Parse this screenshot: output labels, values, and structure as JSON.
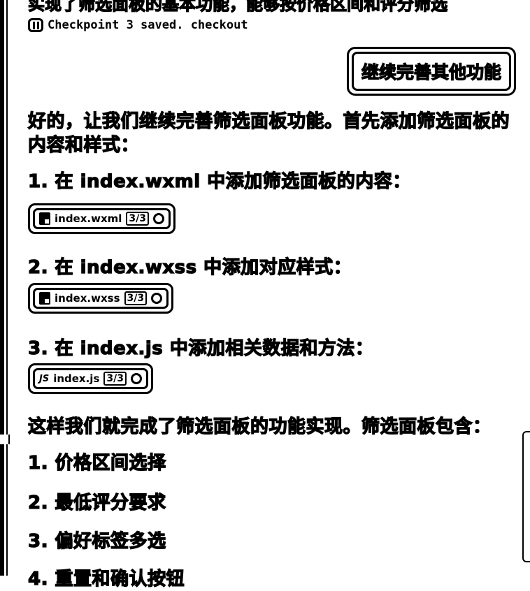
{
  "message": {
    "partial_top_line": "实现了筛选面板的基本功能，能够按价格区间和评分筛选",
    "checkpoint": {
      "icon": "checkpoint-icon",
      "text": "Checkpoint 3 saved. checkout"
    },
    "user_prompt": "继续完善其他功能",
    "intro": "好的，让我们继续完善筛选面板功能。首先添加筛选面板的内容和样式：",
    "steps": [
      {
        "text": "1. 在 index.wxml 中添加筛选面板的内容：",
        "file": {
          "icon": "file-icon",
          "name": "index.wxml",
          "count": "3/3"
        }
      },
      {
        "text": "2. 在 index.wxss 中添加对应样式：",
        "file": {
          "icon": "file-icon",
          "name": "index.wxss",
          "count": "3/3"
        }
      },
      {
        "text": "3. 在 index.js 中添加相关数据和方法：",
        "file": {
          "icon": "JS",
          "name": "index.js",
          "count": "3/3"
        }
      }
    ],
    "summary": "这样我们就完成了筛选面板的功能实现。筛选面板包含：",
    "features": [
      "1. 价格区间选择",
      "2. 最低评分要求",
      "3. 偏好标签多选",
      "4. 重置和确认按钮"
    ]
  }
}
